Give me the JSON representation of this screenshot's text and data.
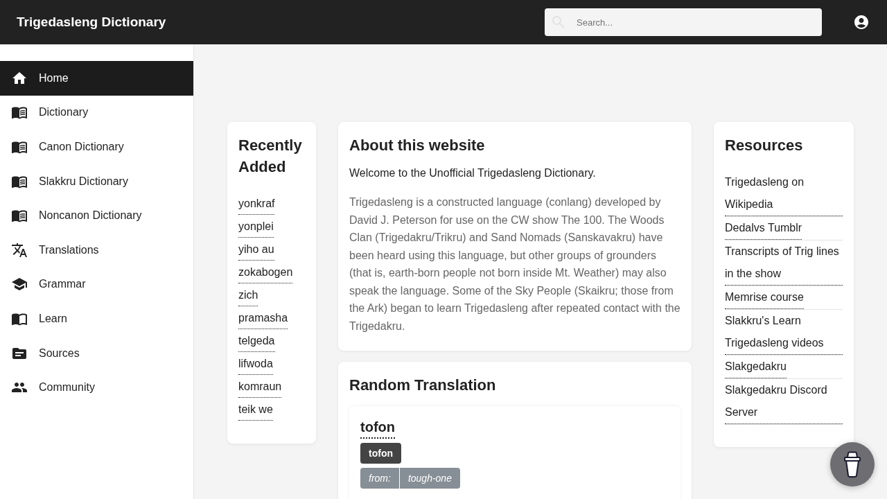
{
  "header": {
    "title": "Trigedasleng Dictionary",
    "search": {
      "placeholder": "Search..."
    }
  },
  "sidebar": {
    "items": [
      {
        "label": "Home",
        "selected": true
      },
      {
        "label": "Dictionary",
        "selected": false
      },
      {
        "label": "Canon Dictionary",
        "selected": false
      },
      {
        "label": "Slakkru Dictionary",
        "selected": false
      },
      {
        "label": "Noncanon Dictionary",
        "selected": false
      },
      {
        "label": "Translations",
        "selected": false
      },
      {
        "label": "Grammar",
        "selected": false
      },
      {
        "label": "Learn",
        "selected": false
      },
      {
        "label": "Sources",
        "selected": false
      },
      {
        "label": "Community",
        "selected": false
      }
    ]
  },
  "recently_added": {
    "title": "Recently Added",
    "words": [
      "yonkraf",
      "yonplei",
      "yiho au",
      "zokabogen",
      "zich",
      "pramasha",
      "telgeda",
      "lifwoda",
      "komraun",
      "teik we"
    ]
  },
  "about": {
    "title": "About this website",
    "intro": "Welcome to the Unofficial Trigedasleng Dictionary.",
    "body": "Trigedasleng is a constructed language (conlang) developed by David J. Peterson for use on the CW show The 100. The Woods Clan (Trigedakru/Trikru) and Sand Nomads (Sanskavakru) have been heard using this language, but other groups of grounders (that is, earth-born people not born inside Mt. Weather) may also speak the language. Some of the Sky People (Skaikru; those from the Ark) began to learn Trigedasleng after repeated contact with the Trigedakru."
  },
  "random_translation": {
    "title": "Random Translation",
    "word": "tofon",
    "tag": "tofon",
    "origin": {
      "label": "from:",
      "value": "tough-one"
    }
  },
  "resources": {
    "title": "Resources",
    "links": [
      "Trigedasleng on Wikipedia",
      "Dedalvs Tumblr",
      "Transcripts of Trig lines in the show",
      "Memrise course",
      "Slakkru's Learn Trigedasleng videos",
      "Slakgedakru",
      "Slakgedakru Discord Server"
    ]
  }
}
